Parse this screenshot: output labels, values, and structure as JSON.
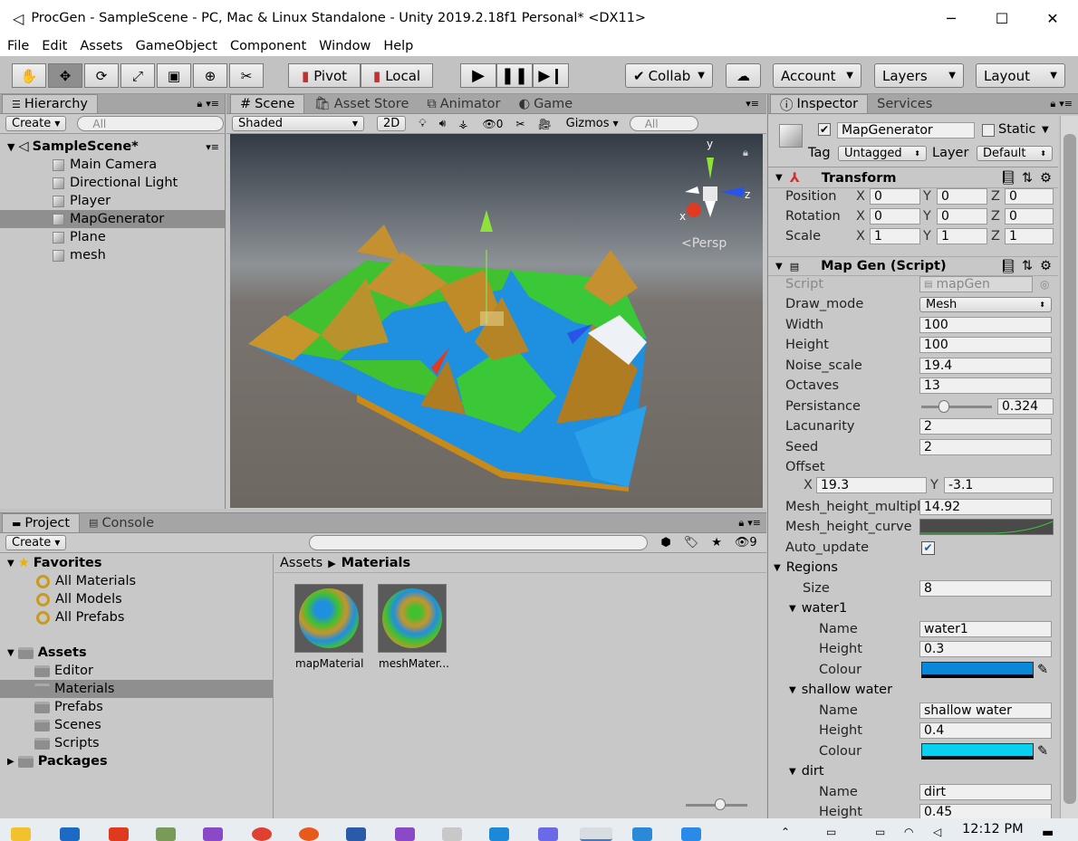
{
  "window": {
    "title": "ProcGen - SampleScene - PC, Mac & Linux Standalone - Unity 2019.2.18f1 Personal* <DX11>"
  },
  "menu": [
    "File",
    "Edit",
    "Assets",
    "GameObject",
    "Component",
    "Window",
    "Help"
  ],
  "toolbar": {
    "pivot": "Pivot",
    "local": "Local",
    "collab": "Collab",
    "account": "Account",
    "layers": "Layers",
    "layout": "Layout"
  },
  "hierarchy": {
    "tab": "Hierarchy",
    "create": "Create",
    "search_placeholder": "All",
    "scene": "SampleScene*",
    "items": [
      "Main Camera",
      "Directional Light",
      "Player",
      "MapGenerator",
      "Plane",
      "mesh"
    ]
  },
  "scene_view": {
    "tabs": [
      "Scene",
      "Asset Store",
      "Animator",
      "Game"
    ],
    "shading": "Shaded",
    "mode_2d": "2D",
    "hidden_count": "0",
    "gizmos": "Gizmos",
    "search_placeholder": "All",
    "persp": "Persp",
    "axes": {
      "x": "x",
      "y": "y",
      "z": "z"
    }
  },
  "project": {
    "tabs": [
      "Project",
      "Console"
    ],
    "create": "Create",
    "hidden_count": "9",
    "favorites": {
      "label": "Favorites",
      "items": [
        "All Materials",
        "All Models",
        "All Prefabs"
      ]
    },
    "assets": {
      "label": "Assets",
      "items": [
        "Editor",
        "Materials",
        "Prefabs",
        "Scenes",
        "Scripts"
      ]
    },
    "packages": "Packages",
    "breadcrumb": {
      "root": "Assets",
      "current": "Materials"
    },
    "files": [
      "mapMaterial",
      "meshMater..."
    ]
  },
  "inspector": {
    "tabs": [
      "Inspector",
      "Services"
    ],
    "object_name": "MapGenerator",
    "static_label": "Static",
    "tag_label": "Tag",
    "tag": "Untagged",
    "layer_label": "Layer",
    "layer": "Default",
    "transform": {
      "title": "Transform",
      "rows": [
        {
          "label": "Position",
          "x": "0",
          "y": "0",
          "z": "0"
        },
        {
          "label": "Rotation",
          "x": "0",
          "y": "0",
          "z": "0"
        },
        {
          "label": "Scale",
          "x": "1",
          "y": "1",
          "z": "1"
        }
      ]
    },
    "mapgen": {
      "title": "Map Gen (Script)",
      "script_label": "Script",
      "script": "mapGen",
      "draw_mode_label": "Draw_mode",
      "draw_mode": "Mesh",
      "width_label": "Width",
      "width": "100",
      "height_label": "Height",
      "height": "100",
      "noise_scale_label": "Noise_scale",
      "noise_scale": "19.4",
      "octaves_label": "Octaves",
      "octaves": "13",
      "persistance_label": "Persistance",
      "persistance": "0.324",
      "persistance_fraction": 0.324,
      "lacunarity_label": "Lacunarity",
      "lacunarity": "2",
      "seed_label": "Seed",
      "seed": "2",
      "offset_label": "Offset",
      "offset_x": "19.3",
      "offset_y": "-3.1",
      "mesh_height_multiplier_label": "Mesh_height_multiplie",
      "mesh_height_multiplier": "14.92",
      "mesh_height_curve_label": "Mesh_height_curve",
      "auto_update_label": "Auto_update",
      "regions_label": "Regions",
      "size_label": "Size",
      "size": "8",
      "regions": [
        {
          "header": "water1",
          "name": "water1",
          "height": "0.3",
          "colour": "#0a88d8"
        },
        {
          "header": "shallow water",
          "name": "shallow water",
          "height": "0.4",
          "colour": "#0ad0f0"
        },
        {
          "header": "dirt",
          "name": "dirt",
          "height": "0.45"
        }
      ],
      "name_label": "Name",
      "height_sub_label": "Height",
      "colour_label": "Colour"
    }
  },
  "taskbar": {
    "time": "12:12 PM"
  }
}
